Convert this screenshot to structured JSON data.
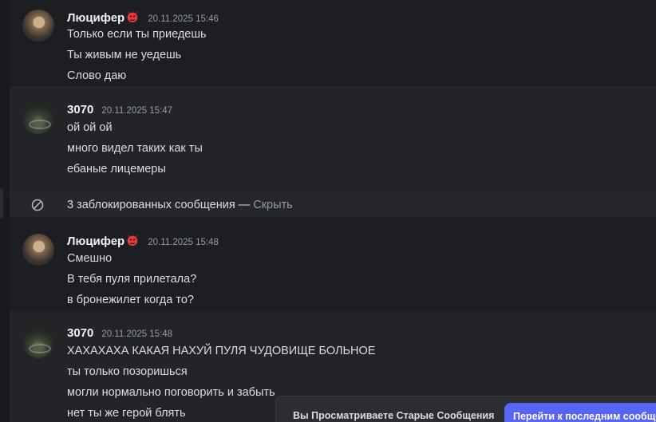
{
  "messages": [
    {
      "author": "Люцифер",
      "timestamp": "20.11.2025 15:46",
      "lines": [
        "Только если ты приедешь",
        "Ты живым не уедешь",
        "Слово даю"
      ]
    },
    {
      "author": "3070",
      "timestamp": "20.11.2025 15:47",
      "lines": [
        "ой ой ой",
        "много видел таких как ты",
        "ебаные лицемеры"
      ]
    },
    {
      "author": "Люцифер",
      "timestamp": "20.11.2025 15:48",
      "lines": [
        "Смешно",
        "В тебя пуля прилетала?",
        "в бронежилет когда то?"
      ]
    },
    {
      "author": "3070",
      "timestamp": "20.11.2025 15:48",
      "lines": [
        "ХАХАХАХА КАКАЯ НАХУЙ ПУЛЯ ЧУДОВИЩЕ БОЛЬНОЕ",
        "ты только позоришься",
        "могли нормально поговорить и забыть",
        "нет ты же герой блять"
      ]
    }
  ],
  "blocked": {
    "text": "3 заблокированных сообщения — ",
    "hide": "Скрыть"
  },
  "jump_bar": {
    "label": "Вы Просматриваете Старые Сообщения",
    "button": "Перейти к последним сообщениям"
  },
  "colors": {
    "accent": "#5865f2",
    "background": "#1a1a1e",
    "text": "#dbdee1",
    "muted": "#949ba4"
  }
}
